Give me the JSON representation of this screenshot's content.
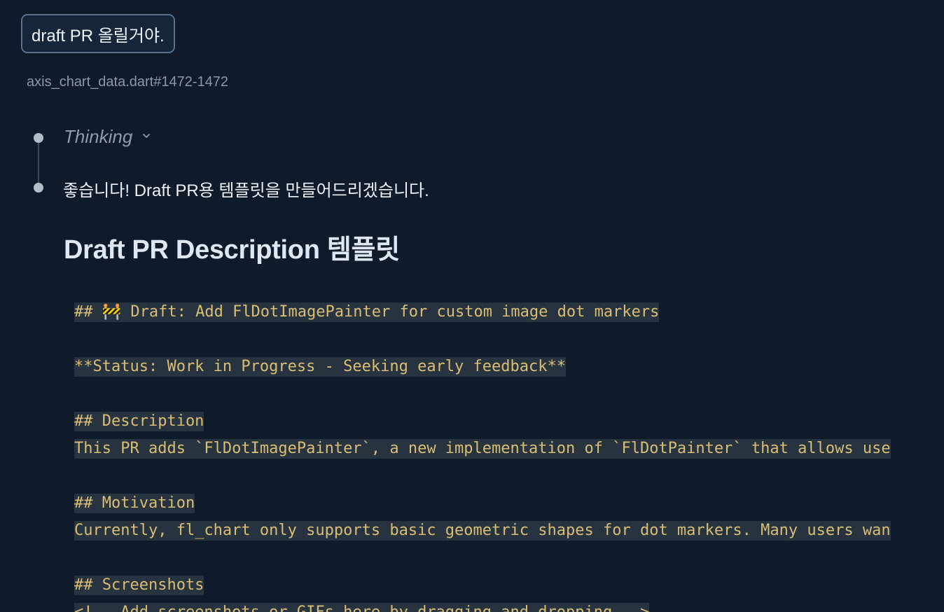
{
  "user_message": "draft PR 올릴거야.",
  "file_reference": "axis_chart_data.dart#1472-1472",
  "thinking_label": "Thinking",
  "reply_text": "좋습니다! Draft PR용 템플릿을 만들어드리겠습니다.",
  "heading": "Draft PR Description 템플릿",
  "code_lines": [
    "## 🚧 Draft: Add FlDotImagePainter for custom image dot markers",
    "**Status: Work in Progress - Seeking early feedback**",
    "## Description",
    "This PR adds `FlDotImagePainter`, a new implementation of `FlDotPainter` that allows use",
    "## Motivation",
    "Currently, fl_chart only supports basic geometric shapes for dot markers. Many users wan",
    "## Screenshots",
    "<!-- Add screenshots or GIFs here by dragging and dropping -->"
  ],
  "icons": {
    "thinking_toggle": "chevron-down-icon",
    "timeline_marker": "dot-icon"
  },
  "colors": {
    "background": "#0f1a2a",
    "code_text": "#d9bd74",
    "code_highlight": "#27343f"
  }
}
